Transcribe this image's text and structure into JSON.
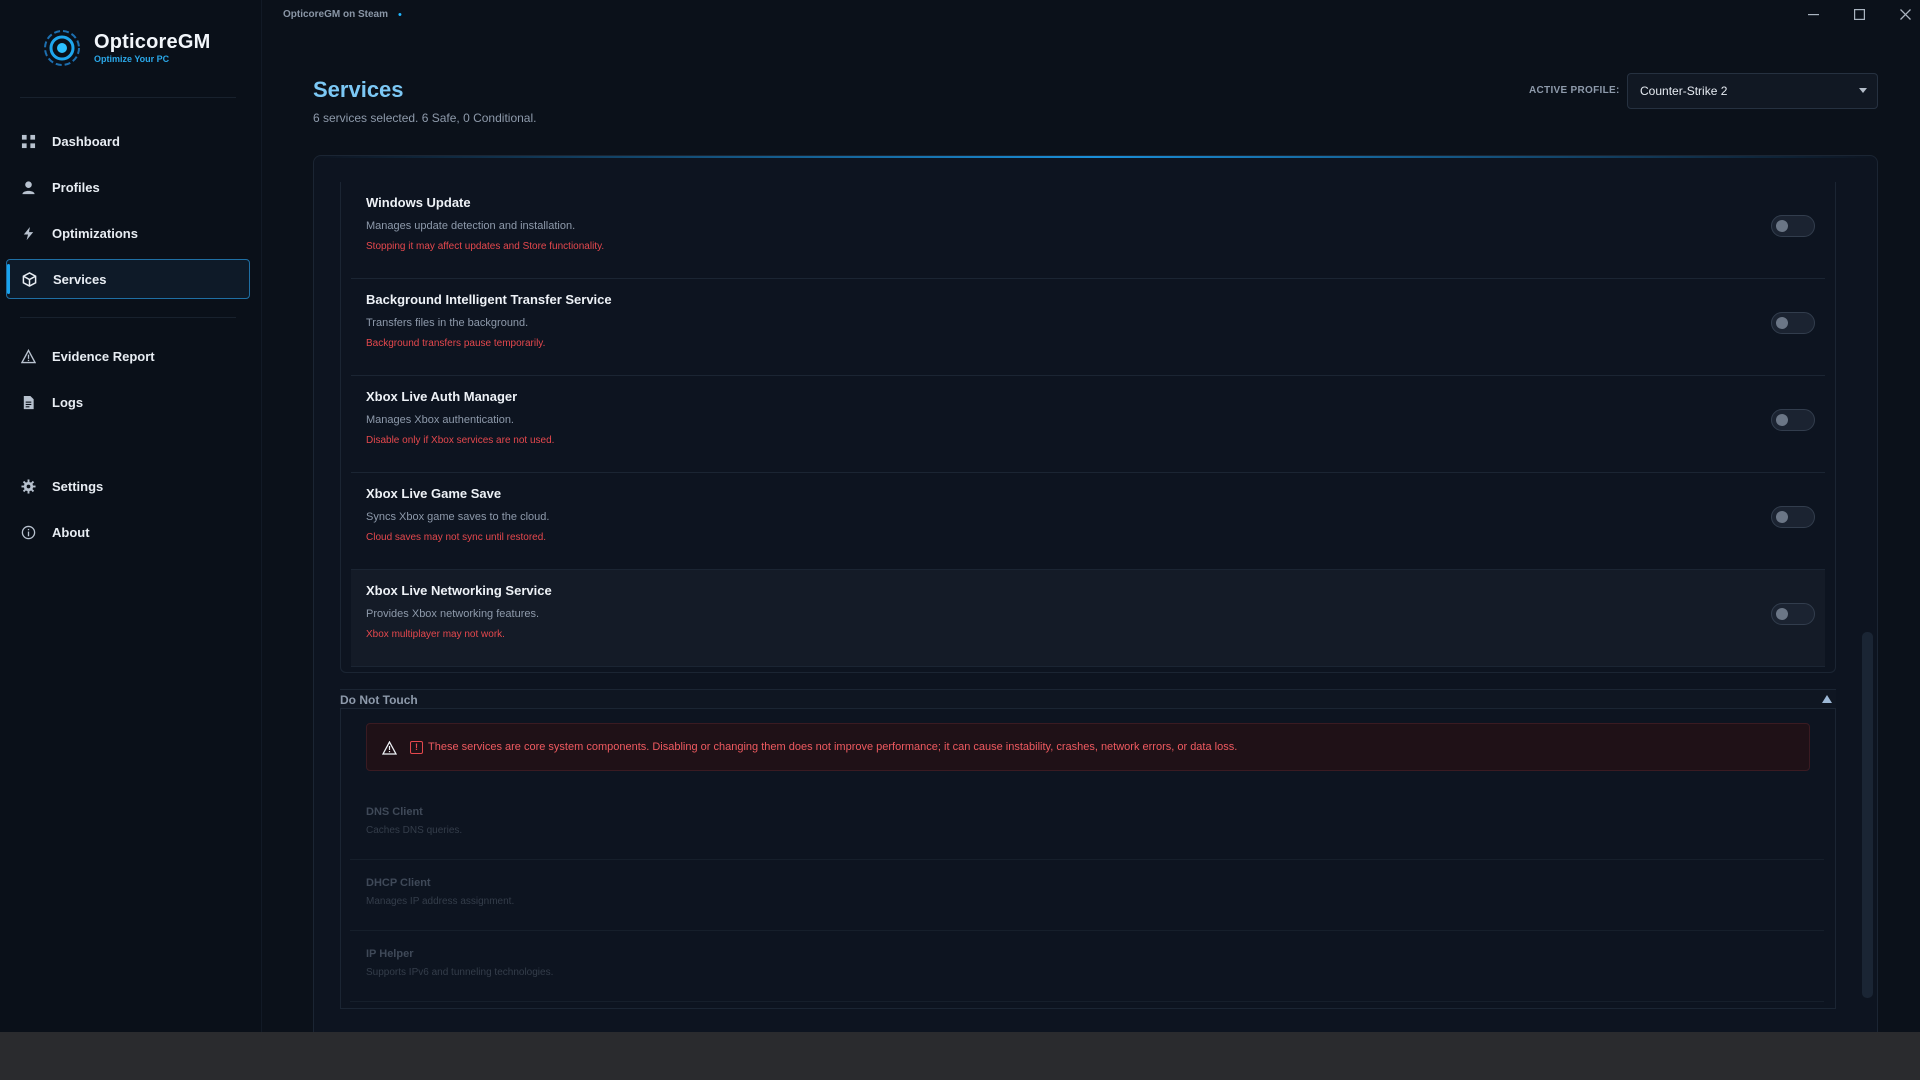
{
  "window": {
    "title": "OpticoreGM on Steam",
    "status_dot": "•"
  },
  "brand": {
    "name": "OpticoreGM",
    "tagline": "Optimize Your PC"
  },
  "sidebar": {
    "items": [
      {
        "label": "Dashboard",
        "icon": "grid-icon"
      },
      {
        "label": "Profiles",
        "icon": "user-icon"
      },
      {
        "label": "Optimizations",
        "icon": "bolt-icon"
      },
      {
        "label": "Services",
        "icon": "cube-icon",
        "active": true
      },
      {
        "label": "Evidence Report",
        "icon": "warning-icon"
      },
      {
        "label": "Logs",
        "icon": "document-icon"
      },
      {
        "label": "Settings",
        "icon": "gear-icon"
      },
      {
        "label": "About",
        "icon": "info-icon"
      }
    ]
  },
  "header": {
    "title": "Services",
    "subtitle": "6 services selected. 6 Safe, 0 Conditional.",
    "profile_label": "ACTIVE PROFILE:",
    "profile_value": "Counter-Strike 2"
  },
  "services": [
    {
      "name": "Windows Update",
      "description": "Manages update detection and installation.",
      "warning": "Stopping it may affect updates and Store functionality.",
      "enabled": false
    },
    {
      "name": "Background Intelligent Transfer Service",
      "description": "Transfers files in the background.",
      "warning": "Background transfers pause temporarily.",
      "enabled": false
    },
    {
      "name": "Xbox Live Auth Manager",
      "description": "Manages Xbox authentication.",
      "warning": "Disable only if Xbox services are not used.",
      "enabled": false
    },
    {
      "name": "Xbox Live Game Save",
      "description": "Syncs Xbox game saves to the cloud.",
      "warning": "Cloud saves may not sync until restored.",
      "enabled": false
    },
    {
      "name": "Xbox Live Networking Service",
      "description": "Provides Xbox networking features.",
      "warning": "Xbox multiplayer may not work.",
      "enabled": false
    }
  ],
  "do_not_touch": {
    "title": "Do Not Touch",
    "alert_badge": "!",
    "alert": "These services are core system components. Disabling or changing them does not improve performance; it can cause instability, crashes, network errors, or data loss.",
    "items": [
      {
        "name": "DNS Client",
        "description": "Caches DNS queries."
      },
      {
        "name": "DHCP Client",
        "description": "Manages IP address assignment."
      },
      {
        "name": "IP Helper",
        "description": "Supports IPv6 and tunneling technologies."
      }
    ]
  },
  "colors": {
    "accent": "#19a3ee",
    "title_blue": "#7cc8f5",
    "warning_red": "#e5484d",
    "background": "#0b111a"
  }
}
